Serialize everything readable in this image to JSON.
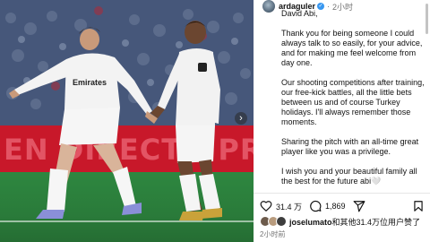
{
  "photo": {
    "banner_text": "EN DIRECTO PRI",
    "jersey_sponsor": "Emirates",
    "next_icon": "chevron-right-icon",
    "colors": {
      "banner": "#c8182a",
      "pitch": "#2e8740",
      "kit": "#f4f4f4"
    }
  },
  "post": {
    "username": "ardaguler",
    "verified_icon": "verified-badge-icon",
    "separator": "·",
    "time_ago": "2小时",
    "caption": {
      "greeting": "David Abi,",
      "p1": "Thank you for being someone I could always talk to so easily, for your advice, and for making me feel welcome from day one.",
      "p2": "Our shooting competitions after training, our free-kick battles, all the little bets between us and of course Turkey holidays. I'll always remember those moments.",
      "p3": "Sharing the pitch with an all-time great player like you was a privilege.",
      "p4": "I wish you and your beautiful family all the best for the future abi🤍"
    },
    "actions": {
      "like_icon": "heart-icon",
      "like_count": "31.4 万",
      "comment_icon": "comment-icon",
      "comment_count": "1,869",
      "share_icon": "share-icon",
      "save_icon": "bookmark-icon"
    },
    "likes": {
      "user": "joselumato",
      "suffix": "和其他31.4万位用户赞了"
    },
    "timestamp": "2小时前"
  },
  "colors": {
    "accent": "#3897f0",
    "text": "#111111",
    "muted": "#737373"
  }
}
